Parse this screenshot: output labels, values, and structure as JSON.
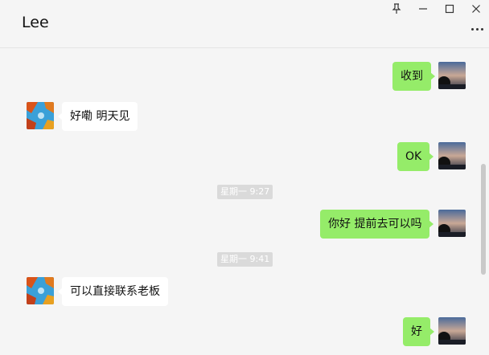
{
  "window": {
    "title": "Lee",
    "controls": [
      "pin-icon",
      "minimize-icon",
      "maximize-icon",
      "close-icon"
    ],
    "menu_icon": "more-icon"
  },
  "colors": {
    "outgoing_bubble": "#95ec69",
    "incoming_bubble": "#ffffff",
    "background": "#f5f5f5",
    "timestamp_bg": "#dadada"
  },
  "messages": [
    {
      "direction": "out",
      "text": "收到"
    },
    {
      "direction": "in",
      "text": "好嘞  明天见"
    },
    {
      "direction": "out",
      "text": "OK"
    },
    {
      "timestamp": "星期一 9:27"
    },
    {
      "direction": "out",
      "text": "你好 提前去可以吗"
    },
    {
      "timestamp": "星期一 9:41"
    },
    {
      "direction": "in",
      "text": "可以直接联系老板"
    },
    {
      "direction": "out",
      "text": "好"
    }
  ]
}
